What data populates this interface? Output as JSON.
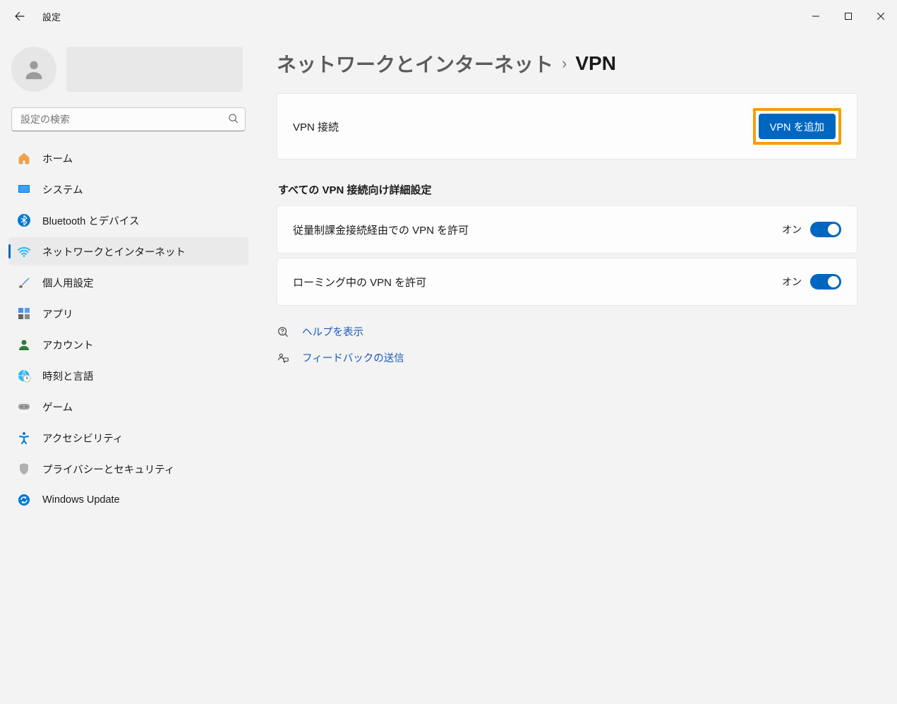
{
  "app_title": "設定",
  "search": {
    "placeholder": "設定の検索"
  },
  "sidebar": {
    "items": [
      {
        "label": "ホーム"
      },
      {
        "label": "システム"
      },
      {
        "label": "Bluetooth とデバイス"
      },
      {
        "label": "ネットワークとインターネット"
      },
      {
        "label": "個人用設定"
      },
      {
        "label": "アプリ"
      },
      {
        "label": "アカウント"
      },
      {
        "label": "時刻と言語"
      },
      {
        "label": "ゲーム"
      },
      {
        "label": "アクセシビリティ"
      },
      {
        "label": "プライバシーとセキュリティ"
      },
      {
        "label": "Windows Update"
      }
    ]
  },
  "breadcrumb": {
    "parent": "ネットワークとインターネット",
    "current": "VPN"
  },
  "vpn_card": {
    "label": "VPN 接続",
    "add_button": "VPN を追加"
  },
  "advanced": {
    "title": "すべての VPN 接続向け詳細設定",
    "metered": {
      "label": "従量制課金接続経由での VPN を許可",
      "state": "オン"
    },
    "roaming": {
      "label": "ローミング中の VPN を許可",
      "state": "オン"
    }
  },
  "help": {
    "show_help": "ヘルプを表示",
    "feedback": "フィードバックの送信"
  }
}
